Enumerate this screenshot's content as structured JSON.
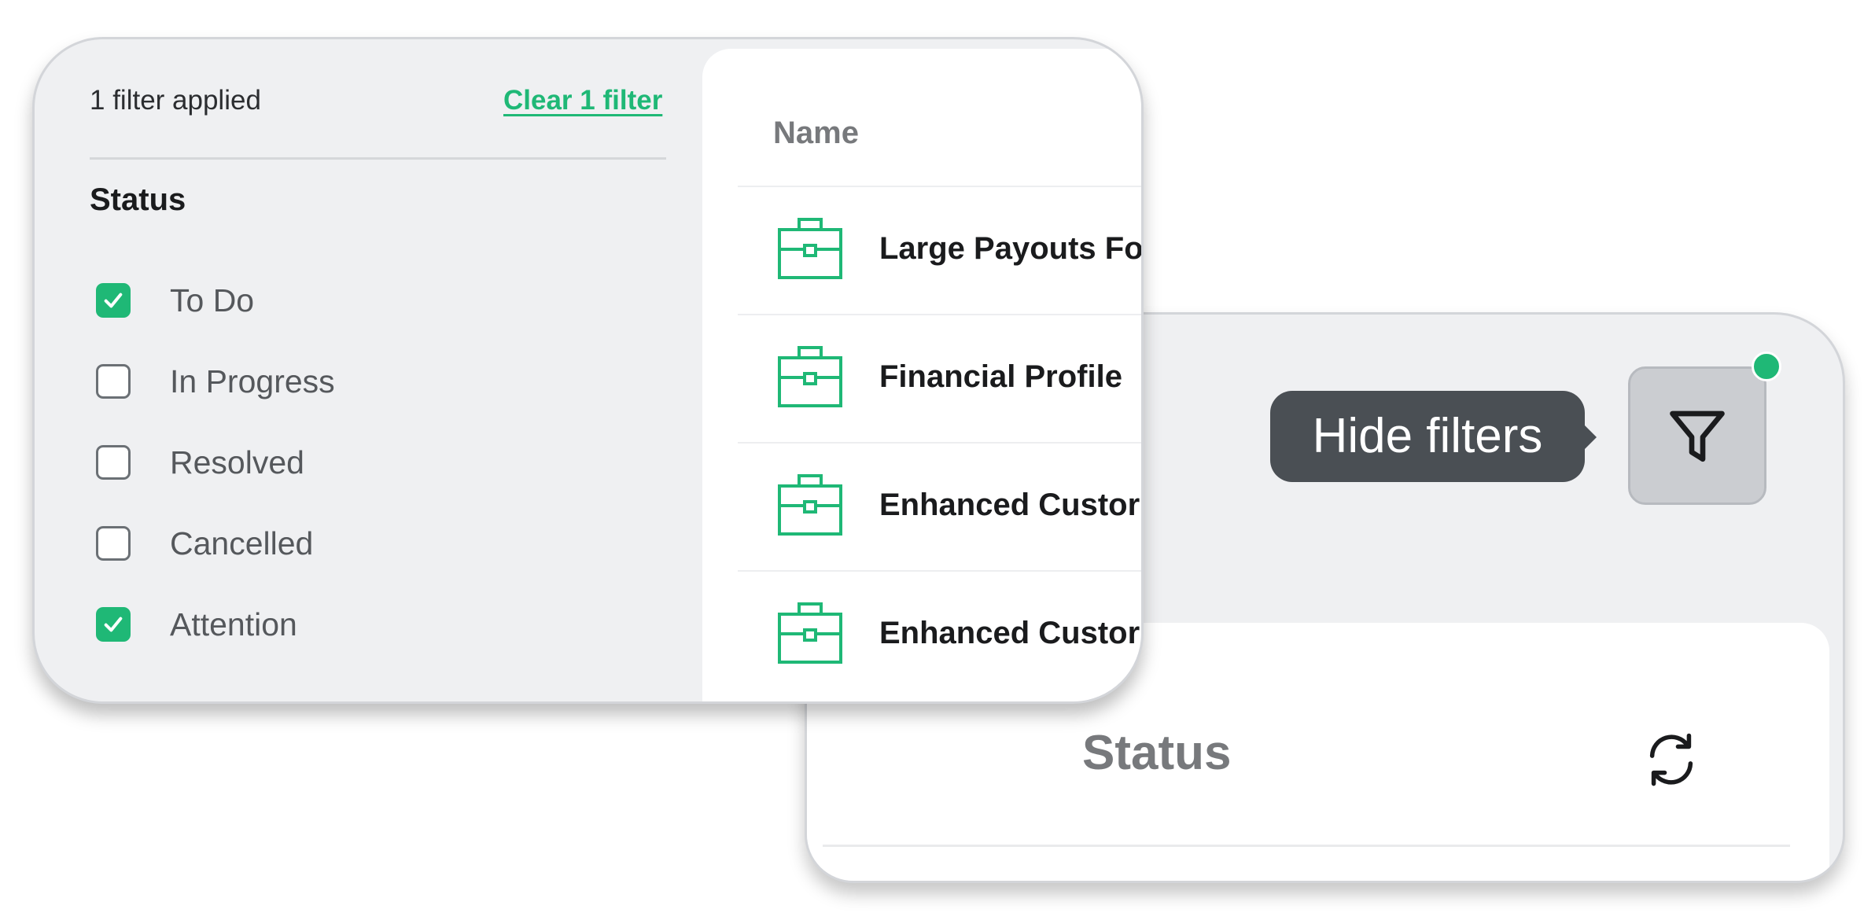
{
  "filters": {
    "summary": "1 filter applied",
    "clear_label": "Clear 1 filter",
    "group_title": "Status",
    "options": [
      {
        "label": "To Do",
        "checked": true
      },
      {
        "label": "In Progress",
        "checked": false
      },
      {
        "label": "Resolved",
        "checked": false
      },
      {
        "label": "Cancelled",
        "checked": false
      },
      {
        "label": "Attention",
        "checked": true
      }
    ]
  },
  "list": {
    "column_header": "Name",
    "rows": [
      {
        "name": "Large Payouts Fo",
        "icon": "briefcase-icon"
      },
      {
        "name": "Financial Profile",
        "icon": "briefcase-icon"
      },
      {
        "name": "Enhanced Custor",
        "icon": "briefcase-icon"
      },
      {
        "name": "Enhanced Custor",
        "icon": "briefcase-icon"
      }
    ]
  },
  "toolbar": {
    "tooltip": "Hide filters",
    "filter_icon": "filter-icon",
    "active_indicator": true
  },
  "status_panel": {
    "title": "Status",
    "refresh_icon": "refresh-icon"
  },
  "colors": {
    "accent": "#1fb876",
    "tooltip_bg": "#4a4f54",
    "card_bg": "#eff0f2"
  }
}
